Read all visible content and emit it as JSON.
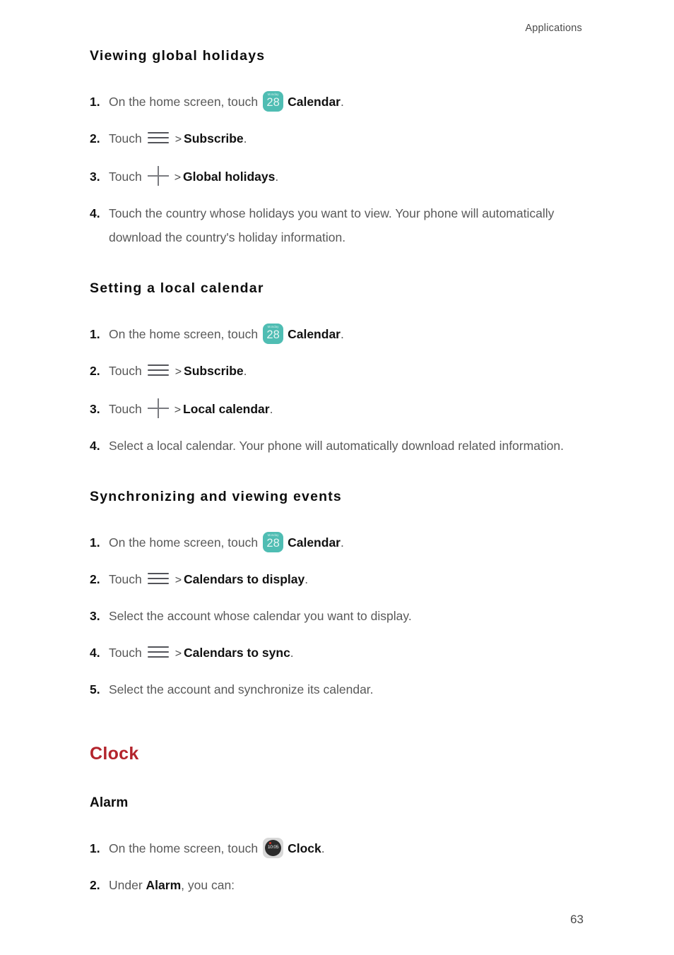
{
  "page": {
    "running_head": "Applications",
    "page_number": "63"
  },
  "colors": {
    "section_title": "#B3242C",
    "body_text": "#595959",
    "bold_text": "#111111",
    "calendar_icon_bg": "#4FBDB3",
    "clock_icon_bg": "#d8d8d8",
    "clock_dial": "#2b2b2b",
    "clock_dot": "#d93025"
  },
  "icons": {
    "calendar": {
      "name": "calendar-icon",
      "day_label": "Monday",
      "date_number": "28"
    },
    "clock": {
      "name": "clock-icon",
      "time_label": "10:05"
    },
    "menu": {
      "name": "hamburger-menu-icon"
    },
    "plus": {
      "name": "plus-icon"
    }
  },
  "sections": [
    {
      "id": "viewing-global-holidays",
      "heading": "Viewing  global  holidays",
      "steps": [
        {
          "num": "1.",
          "pre": "On the home screen, touch",
          "icon": "calendar",
          "bold": "Calendar",
          "post": "."
        },
        {
          "num": "2.",
          "pre": "Touch",
          "icon": "menu",
          "sep": ">",
          "bold": "Subscribe",
          "post": "."
        },
        {
          "num": "3.",
          "pre": "Touch",
          "icon": "plus",
          "sep": ">",
          "bold": "Global holidays",
          "post": "."
        },
        {
          "num": "4.",
          "text": "Touch the country whose holidays you want to view. Your phone will automatically download the country's holiday information."
        }
      ]
    },
    {
      "id": "setting-a-local-calendar",
      "heading": "Setting  a  local  calendar",
      "steps": [
        {
          "num": "1.",
          "pre": "On the home screen, touch",
          "icon": "calendar",
          "bold": "Calendar",
          "post": "."
        },
        {
          "num": "2.",
          "pre": "Touch",
          "icon": "menu",
          "sep": ">",
          "bold": "Subscribe",
          "post": "."
        },
        {
          "num": "3.",
          "pre": "Touch",
          "icon": "plus",
          "sep": ">",
          "bold": "Local calendar",
          "post": "."
        },
        {
          "num": "4.",
          "text": "Select a local calendar. Your phone will automatically download related information."
        }
      ]
    },
    {
      "id": "synchronizing-and-viewing-events",
      "heading": "Synchronizing  and  viewing  events",
      "steps": [
        {
          "num": "1.",
          "pre": "On the home screen, touch",
          "icon": "calendar",
          "bold": "Calendar",
          "post": "."
        },
        {
          "num": "2.",
          "pre": "Touch",
          "icon": "menu",
          "sep": ">",
          "bold": "Calendars to display",
          "post": "."
        },
        {
          "num": "3.",
          "text": "Select the account whose calendar you want to display."
        },
        {
          "num": "4.",
          "pre": "Touch",
          "icon": "menu",
          "sep": ">",
          "bold": "Calendars to sync",
          "post": "."
        },
        {
          "num": "5.",
          "text": "Select the account and synchronize its calendar."
        }
      ]
    }
  ],
  "chapter": {
    "title": "Clock",
    "subsection": {
      "heading": "Alarm",
      "steps": [
        {
          "num": "1.",
          "pre": "On the home screen, touch",
          "icon": "clock",
          "bold": "Clock",
          "post": "."
        },
        {
          "num": "2.",
          "pre2": "Under",
          "bold": "Alarm",
          "post2": ", you can:"
        }
      ]
    }
  }
}
